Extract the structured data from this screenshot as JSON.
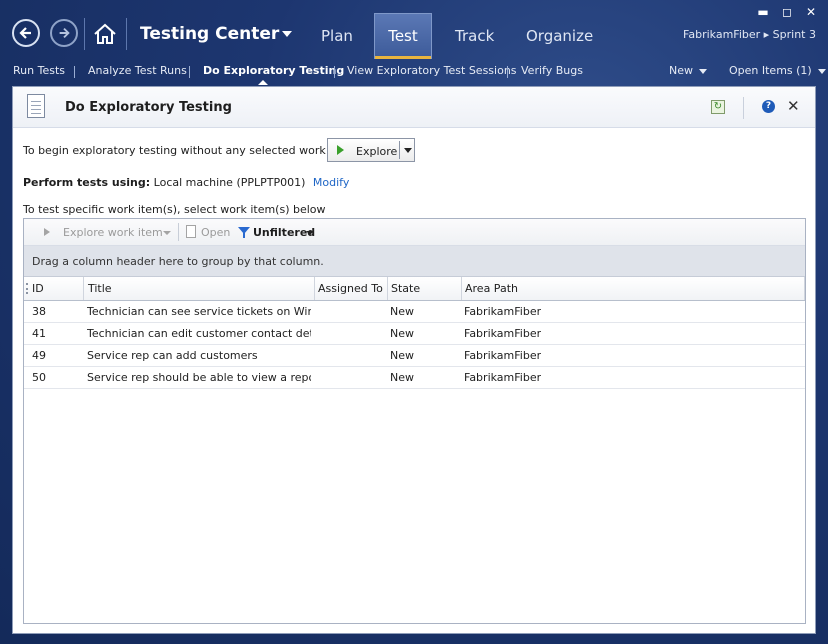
{
  "app": {
    "title": "Testing Center",
    "tabs": [
      {
        "label": "Plan"
      },
      {
        "label": "Test"
      },
      {
        "label": "Track"
      },
      {
        "label": "Organize"
      }
    ],
    "project": "FabrikamFiber ▸ Sprint 3",
    "window_controls": {
      "minimize": "▬",
      "maximize": "◻",
      "close": "✕"
    }
  },
  "subnav": {
    "items": [
      {
        "label": "Run Tests"
      },
      {
        "label": "Analyze Test Runs"
      },
      {
        "label": "Do Exploratory Testing"
      },
      {
        "label": "View Exploratory Test Sessions"
      },
      {
        "label": "Verify Bugs"
      }
    ],
    "new_label": "New",
    "open_items_label": "Open Items (1)"
  },
  "panel": {
    "title": "Do Exploratory Testing",
    "begin_text": "To begin exploratory testing without any selected work items:",
    "explore_label": "Explore",
    "perform_label": "Perform tests using:",
    "machine": "Local machine (PPLPTP001)",
    "modify_label": "Modify",
    "specific_text": "To test specific work item(s), select work item(s) below"
  },
  "toolbar": {
    "explore_item_label": "Explore work item",
    "open_label": "Open",
    "filter_label": "Unfiltered"
  },
  "grid": {
    "group_hint": "Drag a column header here to group by that column.",
    "columns": [
      "ID",
      "Title",
      "Assigned To",
      "State",
      "Area Path"
    ],
    "rows": [
      {
        "id": "38",
        "title": "Technician can see service tickets on Windo...",
        "assigned": "",
        "state": "New",
        "area": "FabrikamFiber"
      },
      {
        "id": "41",
        "title": "Technician can edit customer contact details...",
        "assigned": "",
        "state": "New",
        "area": "FabrikamFiber"
      },
      {
        "id": "49",
        "title": "Service rep can add customers",
        "assigned": "",
        "state": "New",
        "area": "FabrikamFiber"
      },
      {
        "id": "50",
        "title": "Service rep should be able to view a report of...",
        "assigned": "",
        "state": "New",
        "area": "FabrikamFiber"
      }
    ]
  },
  "colors": {
    "accent_tab_underline": "#e9b53f",
    "link": "#1f66c6",
    "explore_play": "#3aa02b"
  }
}
